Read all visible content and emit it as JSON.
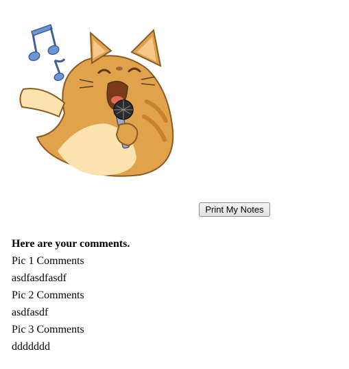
{
  "toolbar": {
    "print_label": "Print My Notes"
  },
  "image": {
    "icon": "singing-cat-sticker",
    "colors": {
      "fur": "#e0a24a",
      "fur_dark": "#c9822c",
      "belly": "#fbe3b0",
      "outline": "#8a5a22",
      "notes": "#6d96d6"
    }
  },
  "comments": {
    "heading": "Here are your comments.",
    "items": [
      {
        "label": "Pic 1 Comments",
        "text": "asdfasdfasdf"
      },
      {
        "label": "Pic 2 Comments",
        "text": "asdfasdf"
      },
      {
        "label": "Pic 3 Comments",
        "text": "ddddddd"
      }
    ]
  }
}
